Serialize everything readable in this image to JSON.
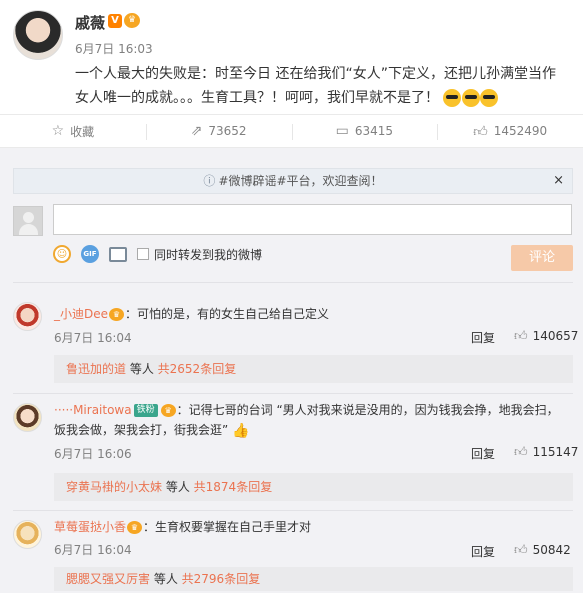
{
  "post": {
    "author": "戚薇",
    "v_badge": "V",
    "vip_badge": "♛",
    "time": "6月7日 16:03",
    "text": "一个人最大的失败是：时至今日 还在给我们“女人”下定义，还把儿孙满堂当作女人唯一的成就。。。生育工具？！呵呵，我们早就不是了！",
    "emoji_count": 3
  },
  "actions": {
    "favorite": "收藏",
    "repost": "73652",
    "comment": "63415",
    "like": "1452490"
  },
  "notice": {
    "text": "#微博辟谣#平台，欢迎查阅！",
    "close": "×"
  },
  "composer": {
    "repost_label": "同时转发到我的微博",
    "submit_label": "评论",
    "gif_label": "GIF"
  },
  "comments": [
    {
      "user": "_小迪Dee",
      "text": "：可怕的是，有的女生自己给自己定义",
      "time": "6月7日 16:04",
      "reply": "回复",
      "likes": "140657",
      "reply_user": "鲁迅加的道",
      "reply_mid": " 等人 ",
      "reply_count": "共2652条回复"
    },
    {
      "user": "·····Miraitowa",
      "fan_badge": "铁粉",
      "text": "：记得七哥的台词 “男人对我来说是没用的，因为钱我会挣，地我会扫，饭我会做，架我会打，街我会逛”",
      "time": "6月7日 16:06",
      "reply": "回复",
      "likes": "115147",
      "reply_user": "穿黄马褂的小太妹",
      "reply_mid": " 等人 ",
      "reply_count": "共1874条回复"
    },
    {
      "user": "草莓蛋挞小香",
      "text": "：生育权要掌握在自己手里才对",
      "time": "6月7日 16:04",
      "reply": "回复",
      "likes": "50842",
      "reply_user": "腮腮又强又厉害",
      "reply_mid": " 等人 ",
      "reply_count": "共2796条回复"
    }
  ],
  "colors": {
    "accent": "#eb7350",
    "submit_disabled": "#f6c9a8",
    "panel_bg": "#f2f2f5"
  }
}
